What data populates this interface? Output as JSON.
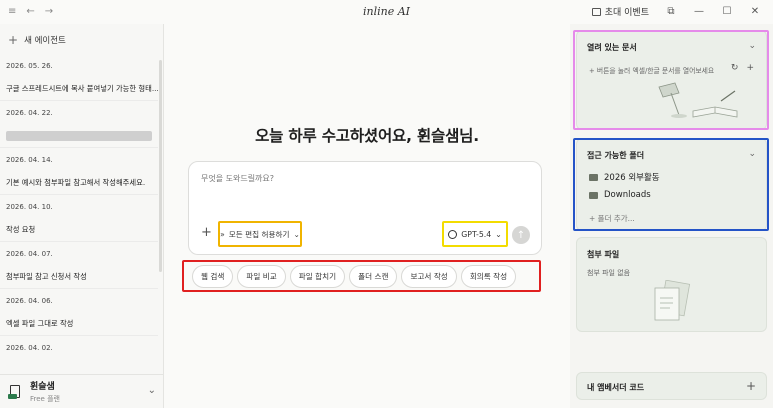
{
  "titlebar": {
    "logo": "inline AI",
    "event_label": "초대 이벤트",
    "icons": [
      "menu-icon",
      "back-arrow-icon",
      "forward-arrow-icon",
      "gift-icon",
      "layout-icon",
      "minimize-icon",
      "maximize-icon",
      "close-icon"
    ],
    "menu": "≡",
    "back": "←",
    "forward": "→",
    "layout": "⧉",
    "minimize": "—",
    "maximize": "☐",
    "close": "✕"
  },
  "sidebar": {
    "new_agent_label": "새 에이전트",
    "history": [
      {
        "kind": "date",
        "text": "2026. 05. 26."
      },
      {
        "kind": "item",
        "text": "구글 스프레드시트에 복사 붙여넣기 가능한 형태..."
      },
      {
        "kind": "date",
        "text": "2026. 04. 22."
      },
      {
        "kind": "blur",
        "text": ""
      },
      {
        "kind": "date",
        "text": "2026. 04. 14."
      },
      {
        "kind": "item",
        "text": "기본 예시와 첨부파일 참고해서 작성해주세요."
      },
      {
        "kind": "date",
        "text": "2026. 04. 10."
      },
      {
        "kind": "item",
        "text": "작성 요청"
      },
      {
        "kind": "date",
        "text": "2026. 04. 07."
      },
      {
        "kind": "item",
        "text": "첨부파일 참고      신청서 작성"
      },
      {
        "kind": "date",
        "text": "2026. 04. 06."
      },
      {
        "kind": "item",
        "text": "엑셀 파일 그대로 작성"
      },
      {
        "kind": "date",
        "text": "2026. 04. 02."
      }
    ],
    "user": {
      "name": "휜슬샘",
      "plan": "Free 플랜"
    }
  },
  "main": {
    "greeting": "오늘 하루 수고하셨어요, 휜슬샘님.",
    "input_placeholder": "무엇을 도와드릴까요?",
    "mode_label": "모든 편집 허용하기",
    "model_label": "GPT-5.4",
    "chips": [
      "웹 검색",
      "파일 비교",
      "파일 합치기",
      "폴더 스캔",
      "보고서 작성",
      "회의록 작성"
    ]
  },
  "right_panel": {
    "open_docs": {
      "title": "열려 있는 문서",
      "hint": "+ 버튼을 눌러 엑셀/한글 문서를 열어보세요"
    },
    "folders": {
      "title": "접근 가능한 폴더",
      "items": [
        "2026 외부활동",
        "Downloads"
      ],
      "add_label": "+ 폴더 추가..."
    },
    "attachments": {
      "title": "첨부 파일",
      "empty_label": "첨부 파일 없음"
    },
    "ambassador": {
      "title": "내 앰베서더 코드"
    }
  },
  "colors": {
    "highlight_pink": "#e58bea",
    "highlight_blue": "#2453c7",
    "highlight_orange": "#f0b400",
    "highlight_yellow": "#f3dc00",
    "highlight_red": "#e02020",
    "card_bg": "#ebefe9"
  }
}
